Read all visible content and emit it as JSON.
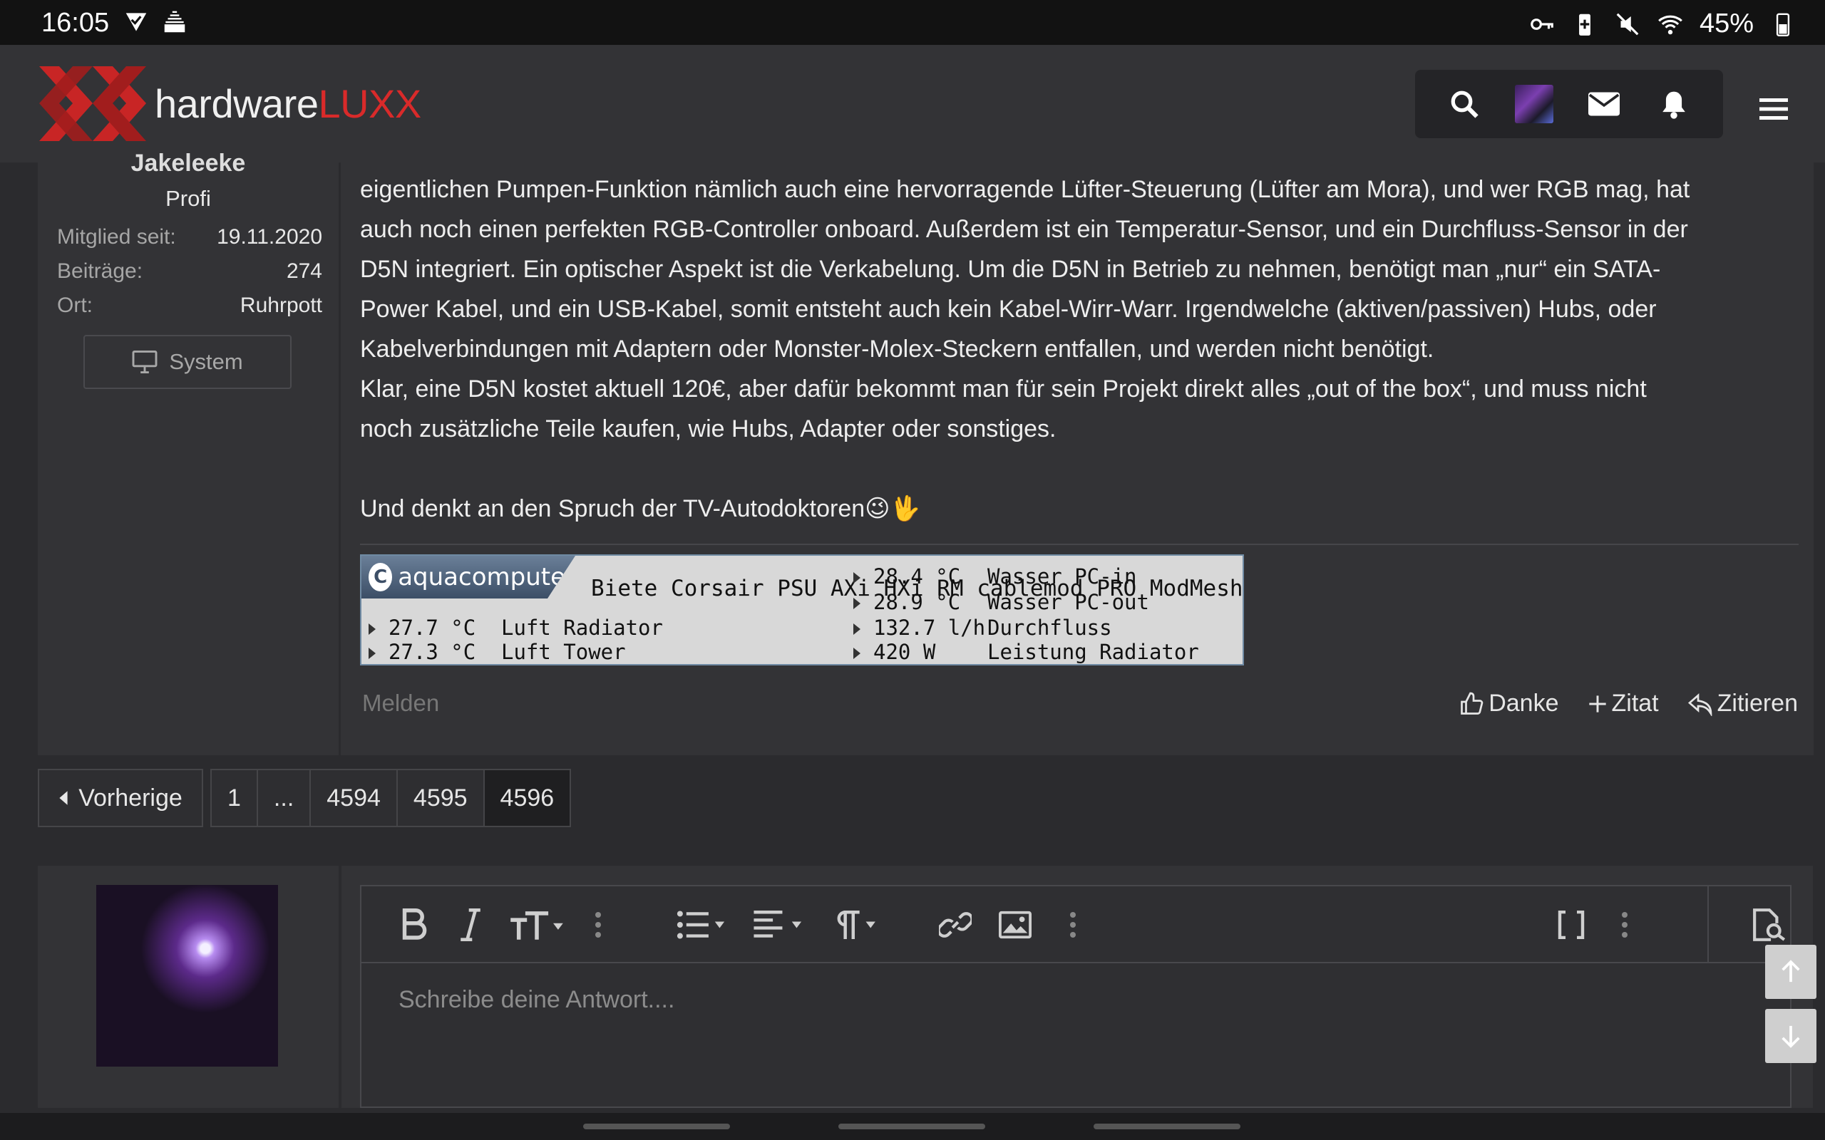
{
  "status_bar": {
    "time": "16:05",
    "battery": "45%",
    "left_icons": [
      "verified-icon",
      "signal-bars-icon"
    ],
    "right_icons": [
      "key-icon",
      "battery-saver-icon",
      "mute-icon",
      "wifi-icon",
      "battery-icon"
    ]
  },
  "header": {
    "logo_word_1": "hardware",
    "logo_word_2": "LUXX",
    "brand_color": "#d92a2a",
    "nav_icons": [
      "search-icon",
      "avatar",
      "mail-icon",
      "bell-icon",
      "hamburger-icon"
    ]
  },
  "user": {
    "name": "Jakeleeke",
    "title": "Profi",
    "stats": [
      {
        "label": "Mitglied seit:",
        "value": "19.11.2020"
      },
      {
        "label": "Beiträge:",
        "value": "274"
      },
      {
        "label": "Ort:",
        "value": "Ruhrpott"
      }
    ],
    "system_button": "System"
  },
  "post": {
    "lines": [
      "eigentlichen Pumpen-Funktion nämlich auch eine hervorragende Lüfter-Steuerung (Lüfter am Mora), und wer RGB mag, hat",
      "auch noch einen perfekten RGB-Controller onboard. Außerdem ist ein Temperatur-Sensor, und ein Durchfluss-Sensor in der",
      "D5N integriert. Ein optischer Aspekt ist die Verkabelung. Um die D5N in Betrieb zu nehmen, benötigt man „nur“ ein SATA-",
      "Power Kabel, und ein USB-Kabel, somit entsteht auch kein Kabel-Wirr-Warr. Irgendwelche (aktiven/passiven) Hubs, oder",
      "Kabelverbindungen mit Adaptern oder Monster-Molex-Steckern entfallen, und werden nicht benötigt.",
      "Klar, eine D5N kostet aktuell 120€, aber dafür bekommt man für sein Projekt direkt alles „out of the box“, und muss nicht",
      "noch zusätzliche Teile kaufen, wie Hubs, Adapter oder sonstiges.",
      "",
      "Und denkt an den Spruch der TV-Autodoktoren😉🖖"
    ],
    "signature": {
      "brand": "aquacomputer",
      "banner": "Biete Corsair PSU AXi HXi RM cablemod PRO ModMesh „NEU",
      "left_rows": [
        {
          "value": "27.7 °C",
          "label": "Luft Radiator"
        },
        {
          "value": "27.3 °C",
          "label": "Luft Tower"
        }
      ],
      "right_rows": [
        {
          "value": "28.4 °C",
          "label": "Wasser PC-in"
        },
        {
          "value": "28.9 °C",
          "label": "Wasser PC-out"
        },
        {
          "value": "132.7 l/h",
          "label": "Durchfluss"
        },
        {
          "value": "420 W",
          "label": "Leistung Radiator"
        }
      ]
    },
    "report": "Melden",
    "actions": {
      "thanks": "Danke",
      "quote_add": "Zitat",
      "quote": "Zitieren"
    }
  },
  "pagination": {
    "prev": "Vorherige",
    "pages": [
      "1",
      "...",
      "4594",
      "4595",
      "4596"
    ],
    "active": "4596"
  },
  "reply": {
    "placeholder": "Schreibe deine Antwort...."
  }
}
